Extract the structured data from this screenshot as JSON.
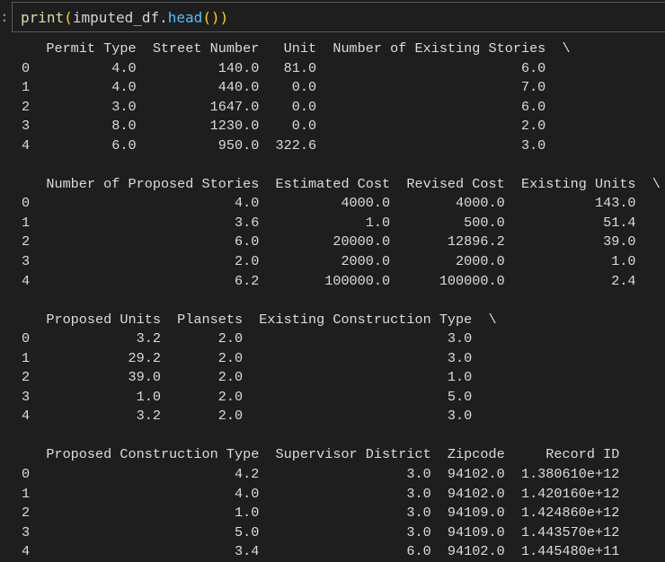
{
  "prompt": {
    "marker": ":"
  },
  "code_cell": {
    "fn": "print",
    "open_paren": "(",
    "var": "imputed_df",
    "dot": ".",
    "method": "head",
    "call_parens": "()",
    "close_paren": ")"
  },
  "output": {
    "lines": [
      "   Permit Type  Street Number   Unit  Number of Existing Stories  \\",
      "0          4.0          140.0   81.0                         6.0   ",
      "1          4.0          440.0    0.0                         7.0   ",
      "2          3.0         1647.0    0.0                         6.0   ",
      "3          8.0         1230.0    0.0                         2.0   ",
      "4          6.0          950.0  322.6                         3.0   ",
      "",
      "   Number of Proposed Stories  Estimated Cost  Revised Cost  Existing Units  \\",
      "0                         4.0          4000.0        4000.0           143.0   ",
      "1                         3.6             1.0         500.0            51.4   ",
      "2                         6.0         20000.0       12896.2            39.0   ",
      "3                         2.0          2000.0        2000.0             1.0   ",
      "4                         6.2        100000.0      100000.0             2.4   ",
      "",
      "   Proposed Units  Plansets  Existing Construction Type  \\",
      "0             3.2       2.0                         3.0   ",
      "1            29.2       2.0                         3.0   ",
      "2            39.0       2.0                         1.0   ",
      "3             1.0       2.0                         5.0   ",
      "4             3.2       2.0                         3.0   ",
      "",
      "   Proposed Construction Type  Supervisor District  Zipcode     Record ID  ",
      "0                         4.2                  3.0  94102.0  1.380610e+12  ",
      "1                         4.0                  3.0  94102.0  1.420160e+12  ",
      "2                         1.0                  3.0  94109.0  1.424860e+12  ",
      "3                         5.0                  3.0  94109.0  1.443570e+12  ",
      "4                         3.4                  6.0  94102.0  1.445480e+11  "
    ]
  }
}
